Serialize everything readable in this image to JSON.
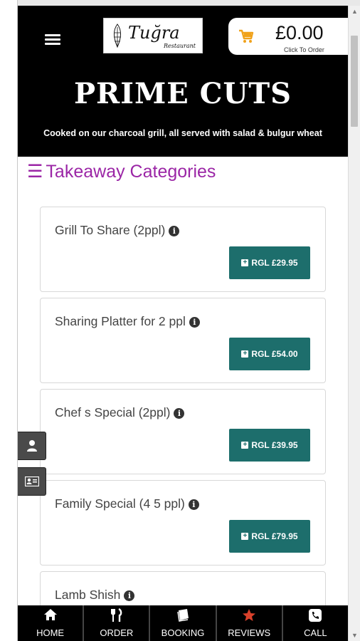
{
  "header": {
    "logo": {
      "name": "Tuğra",
      "sub": "Restaurant"
    },
    "cart": {
      "amount": "£0.00",
      "subtext": "Click To Order"
    },
    "title": "PRIME CUTS",
    "subtitle": "Cooked on our charcoal grill, all served with salad & bulgur wheat"
  },
  "categories": {
    "heading_icon": "☰",
    "heading": "Takeaway Categories",
    "items": [
      {
        "title": "Grill To Share (2ppl)",
        "price": "RGL £29.95"
      },
      {
        "title": "Sharing Platter for 2 ppl",
        "price": "RGL £54.00"
      },
      {
        "title": "Chef s Special (2ppl)",
        "price": "RGL £39.95"
      },
      {
        "title": "Family Special (4 5 ppl)",
        "price": "RGL £79.95"
      },
      {
        "title": "Lamb Shish",
        "price": ""
      }
    ]
  },
  "side_buttons": [
    {
      "icon": "user-icon"
    },
    {
      "icon": "id-card-icon"
    }
  ],
  "nav": {
    "items": [
      {
        "label": "HOME",
        "icon": "home-icon"
      },
      {
        "label": "ORDER",
        "icon": "cutlery-icon"
      },
      {
        "label": "BOOKING",
        "icon": "book-icon"
      },
      {
        "label": "REVIEWS",
        "icon": "star-icon"
      },
      {
        "label": "CALL",
        "icon": "phone-icon"
      }
    ]
  },
  "colors": {
    "accent": "#9b26a6",
    "button": "#1d6e6c",
    "cart_icon": "#f0a21b",
    "review_star": "#d9412b",
    "header_bg": "#000000"
  }
}
